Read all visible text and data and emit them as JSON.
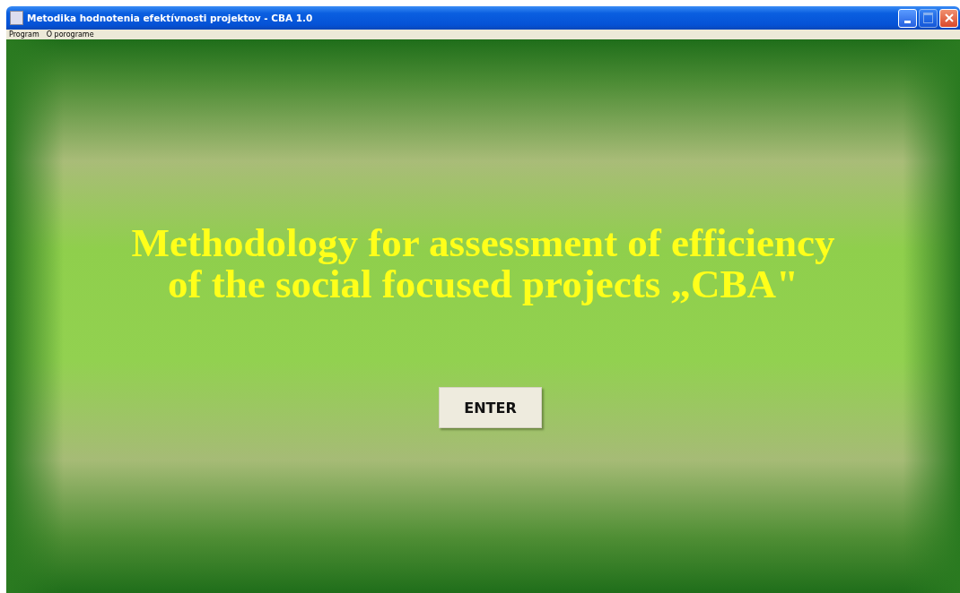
{
  "window": {
    "title": "Metodika hodnotenia efektívnosti projektov - CBA 1.0",
    "maximize_disabled": true
  },
  "menu": [
    "Program",
    "O porograme"
  ],
  "heading": [
    "Methodology for assessment of efficiency",
    "of the social focused projects „CBA\""
  ],
  "button": "ENTER"
}
